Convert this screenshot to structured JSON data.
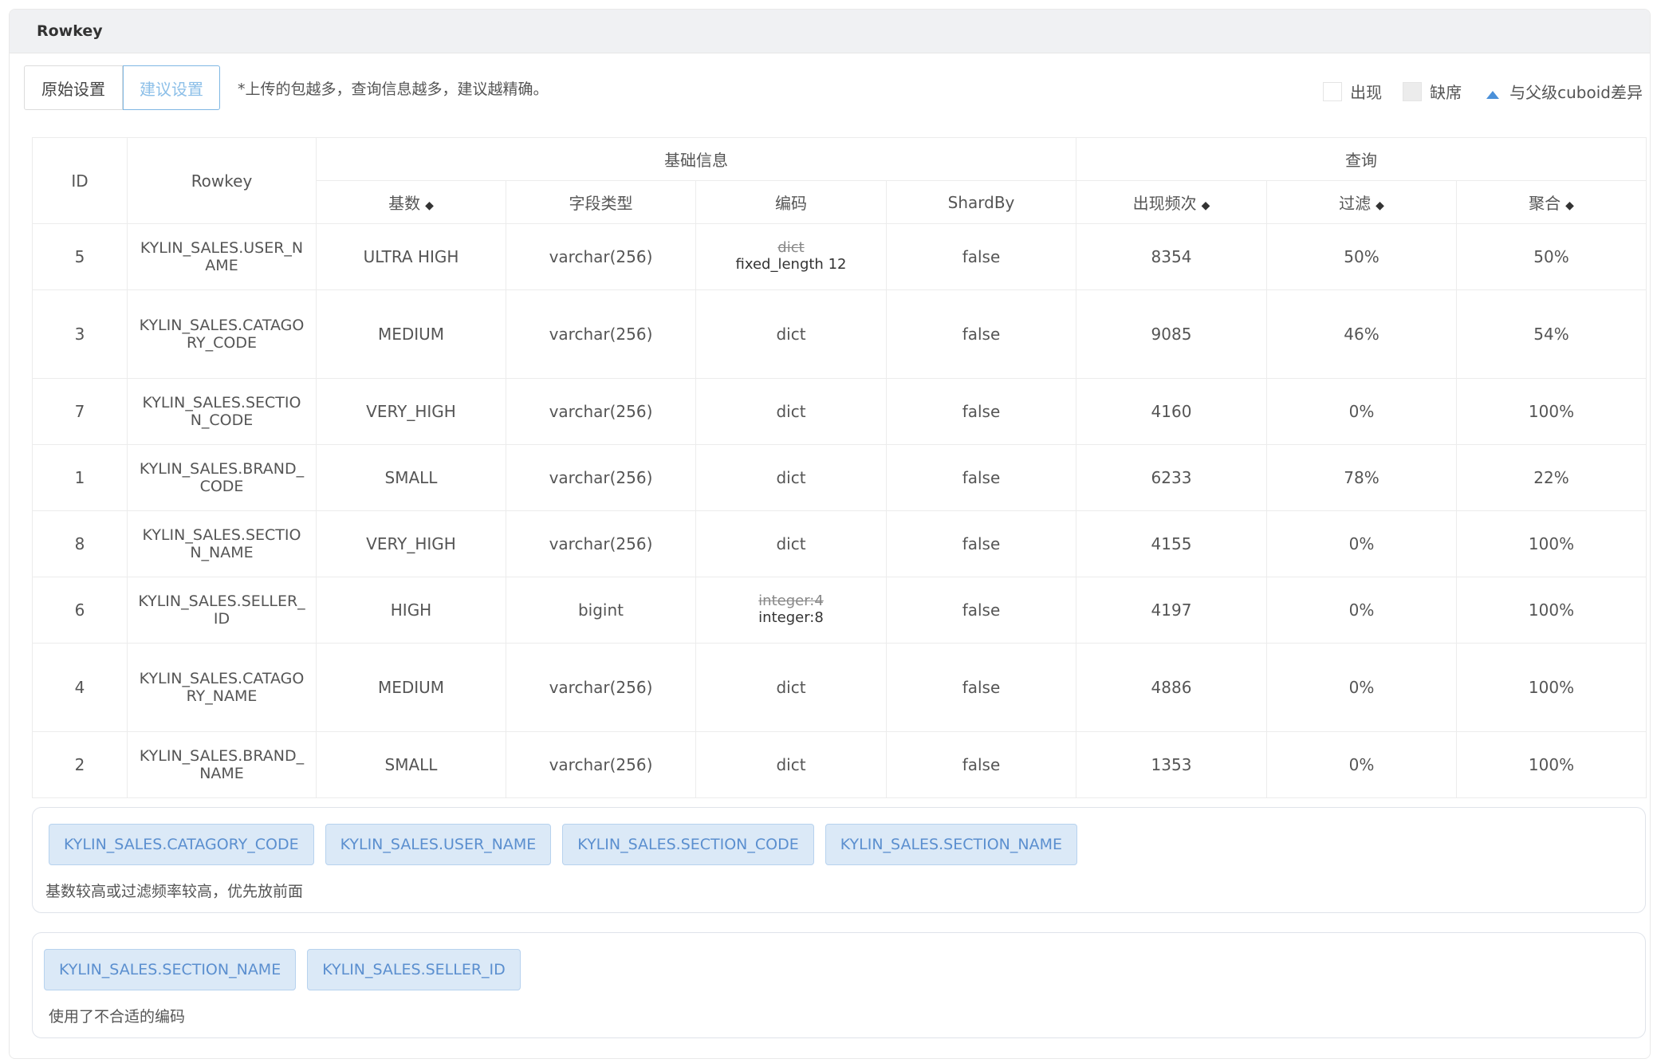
{
  "panel_title": "Rowkey",
  "tabs": {
    "original": "原始设置",
    "suggested": "建议设置"
  },
  "hint": "*上传的包越多，查询信息越多，建议越精确。",
  "legend": {
    "present": "出现",
    "missing": "缺席",
    "diff": "与父级cuboid差异"
  },
  "header": {
    "id": "ID",
    "rowkey": "Rowkey",
    "group_basic": "基础信息",
    "group_query": "查询",
    "cardinality": "基数",
    "field_type": "字段类型",
    "encoding": "编码",
    "shardby": "ShardBy",
    "frequency": "出现频次",
    "filter": "过滤",
    "aggregate": "聚合",
    "sort_icon": "sort-icon"
  },
  "rows": [
    {
      "id": "5",
      "rowkey": "KYLIN_SALES.USER_NAME",
      "cardinality": "ULTRA HIGH",
      "type": "varchar(256)",
      "encoding_old": "dict",
      "encoding": "fixed_length 12",
      "shardby": "false",
      "frequency": "8354",
      "filter": "50%",
      "aggregate": "50%"
    },
    {
      "id": "3",
      "rowkey": "KYLIN_SALES.CATAGORY_CODE",
      "cardinality": "MEDIUM",
      "type": "varchar(256)",
      "encoding_old": "",
      "encoding": "dict",
      "shardby": "false",
      "frequency": "9085",
      "filter": "46%",
      "aggregate": "54%"
    },
    {
      "id": "7",
      "rowkey": "KYLIN_SALES.SECTION_CODE",
      "cardinality": "VERY_HIGH",
      "type": "varchar(256)",
      "encoding_old": "",
      "encoding": "dict",
      "shardby": "false",
      "frequency": "4160",
      "filter": "0%",
      "aggregate": "100%"
    },
    {
      "id": "1",
      "rowkey": "KYLIN_SALES.BRAND_CODE",
      "cardinality": "SMALL",
      "type": "varchar(256)",
      "encoding_old": "",
      "encoding": "dict",
      "shardby": "false",
      "frequency": "6233",
      "filter": "78%",
      "aggregate": "22%"
    },
    {
      "id": "8",
      "rowkey": "KYLIN_SALES.SECTION_NAME",
      "cardinality": "VERY_HIGH",
      "type": "varchar(256)",
      "encoding_old": "",
      "encoding": "dict",
      "shardby": "false",
      "frequency": "4155",
      "filter": "0%",
      "aggregate": "100%"
    },
    {
      "id": "6",
      "rowkey": "KYLIN_SALES.SELLER_ID",
      "cardinality": "HIGH",
      "type": "bigint",
      "encoding_old": "integer:4",
      "encoding": "integer:8",
      "shardby": "false",
      "frequency": "4197",
      "filter": "0%",
      "aggregate": "100%"
    },
    {
      "id": "4",
      "rowkey": "KYLIN_SALES.CATAGORY_NAME",
      "cardinality": "MEDIUM",
      "type": "varchar(256)",
      "encoding_old": "",
      "encoding": "dict",
      "shardby": "false",
      "frequency": "4886",
      "filter": "0%",
      "aggregate": "100%"
    },
    {
      "id": "2",
      "rowkey": "KYLIN_SALES.BRAND_NAME",
      "cardinality": "SMALL",
      "type": "varchar(256)",
      "encoding_old": "",
      "encoding": "dict",
      "shardby": "false",
      "frequency": "1353",
      "filter": "0%",
      "aggregate": "100%"
    }
  ],
  "suggestion_1": {
    "tags": [
      "KYLIN_SALES.CATAGORY_CODE",
      "KYLIN_SALES.USER_NAME",
      "KYLIN_SALES.SECTION_CODE",
      "KYLIN_SALES.SECTION_NAME"
    ],
    "note": "基数较高或过滤频率较高，优先放前面"
  },
  "suggestion_2": {
    "tags": [
      "KYLIN_SALES.SECTION_NAME",
      "KYLIN_SALES.SELLER_ID"
    ],
    "note": "使用了不合适的编码"
  },
  "colors": {
    "accent": "#7fb7e3",
    "tag_bg": "#dbe9f7",
    "tag_text": "#5b8fcf",
    "header_bg": "#f0f1f3"
  }
}
